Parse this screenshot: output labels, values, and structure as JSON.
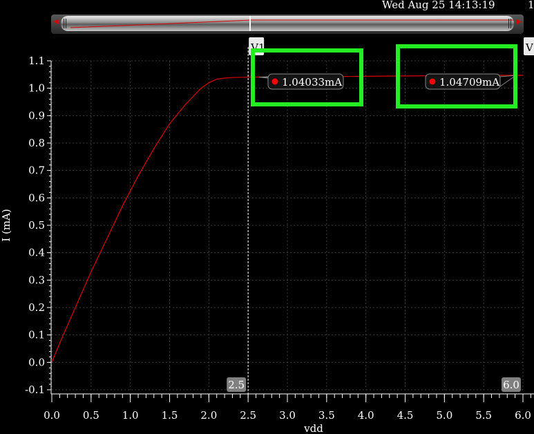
{
  "header": {
    "timestamp": "Wed Aug 25 14:13:19",
    "corner_text": "1"
  },
  "markers": [
    {
      "label": "V1",
      "x": 2.5
    },
    {
      "label": "V",
      "x": 6.0
    }
  ],
  "cursor_readouts": [
    {
      "value_text": "1.04033mA",
      "x": 2.5,
      "y": 1.04033
    },
    {
      "value_text": "1.04709mA",
      "x": 6.0,
      "y": 1.04709
    }
  ],
  "cursor_x_labels": [
    "2.5",
    "6.0"
  ],
  "colors": {
    "background": "#000000",
    "trace": "#dd0000",
    "highlight_box": "#22ee22",
    "grid": "#3c3c3c",
    "axis_text": "#ffffff",
    "marker_dot": "#ff0000"
  },
  "chart_data": {
    "type": "line",
    "xlabel": "vdd",
    "ylabel": "I (mA)",
    "xlim": [
      0.0,
      6.0
    ],
    "ylim": [
      -0.1,
      1.1
    ],
    "xticks": [
      "0.0",
      "0.5",
      "1.0",
      "1.5",
      "2.0",
      "2.5",
      "3.0",
      "3.5",
      "4.0",
      "4.5",
      "5.0",
      "5.5",
      "6.0"
    ],
    "yticks": [
      "-0.1",
      "0.0",
      "0.1",
      "0.2",
      "0.3",
      "0.4",
      "0.5",
      "0.6",
      "0.7",
      "0.8",
      "0.9",
      "1.0",
      "1.1"
    ],
    "grid": true,
    "series": [
      {
        "x": [
          0.0,
          0.1,
          0.3,
          0.5,
          0.7,
          0.9,
          1.1,
          1.3,
          1.5,
          1.7,
          1.9,
          2.0,
          2.1,
          2.2,
          2.3,
          2.5,
          3.0,
          3.5,
          4.0,
          4.5,
          5.0,
          5.5,
          6.0
        ],
        "y": [
          0.0,
          0.07,
          0.2,
          0.33,
          0.45,
          0.57,
          0.68,
          0.78,
          0.87,
          0.94,
          1.0,
          1.02,
          1.033,
          1.037,
          1.039,
          1.0403,
          1.0414,
          1.0425,
          1.0436,
          1.0448,
          1.0459,
          1.047,
          1.0471
        ]
      }
    ]
  }
}
